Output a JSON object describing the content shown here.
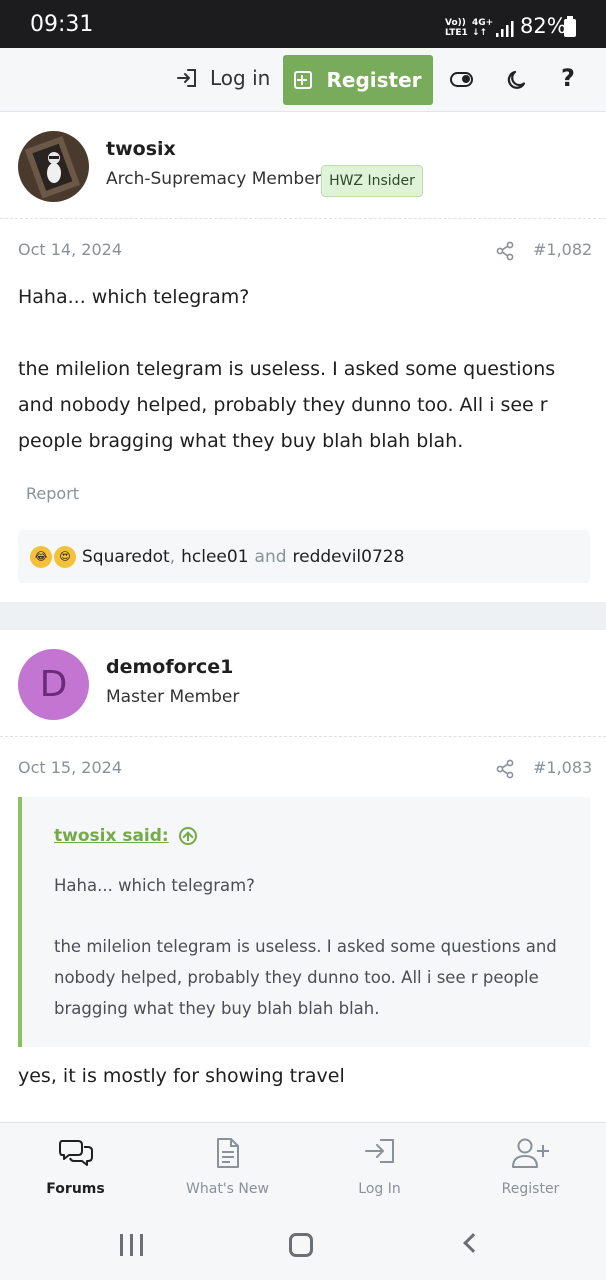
{
  "status_bar": {
    "time": "09:31",
    "network_line1": "Vo))",
    "network_line2": "LTE1",
    "network_type": "4G+",
    "network_arrows": "↓↑",
    "battery": "82%"
  },
  "top_nav": {
    "login_label": "Log in",
    "register_label": "Register",
    "help_label": "?"
  },
  "posts": [
    {
      "username": "twosix",
      "user_title": "Arch-Supremacy Member",
      "badge": "HWZ Insider",
      "date": "Oct 14, 2024",
      "post_number": "#1,082",
      "paragraphs": [
        "Haha... which telegram?",
        "the milelion telegram is useless. I asked some questions and nobody helped, probably they dunno too. All i see r people bragging what they buy blah blah blah."
      ],
      "report_label": "Report",
      "reactions": {
        "users": [
          "Squaredot",
          "hclee01",
          "reddevil0728"
        ],
        "separator": ",",
        "conjunction": "and"
      }
    },
    {
      "username": "demoforce1",
      "avatar_letter": "D",
      "user_title": "Master Member",
      "date": "Oct 15, 2024",
      "post_number": "#1,083",
      "quote": {
        "author": "twosix said:",
        "paragraphs": [
          "Haha... which telegram?",
          "the milelion telegram is useless. I asked some questions and nobody helped, probably they dunno too. All i see r people bragging what they buy blah blah blah."
        ]
      },
      "body": "yes, it is mostly for showing travel"
    }
  ],
  "tab_bar": [
    {
      "label": "Forums",
      "icon": "chat-bubbles-icon",
      "active": true
    },
    {
      "label": "What's New",
      "icon": "document-icon",
      "active": false
    },
    {
      "label": "Log In",
      "icon": "login-arrow-icon",
      "active": false
    },
    {
      "label": "Register",
      "icon": "add-user-icon",
      "active": false
    }
  ],
  "colors": {
    "accent_green": "#78ac5a",
    "quote_bar": "#8bc160",
    "demoforce_avatar": "#c275d1",
    "muted_text": "#8a9199"
  }
}
